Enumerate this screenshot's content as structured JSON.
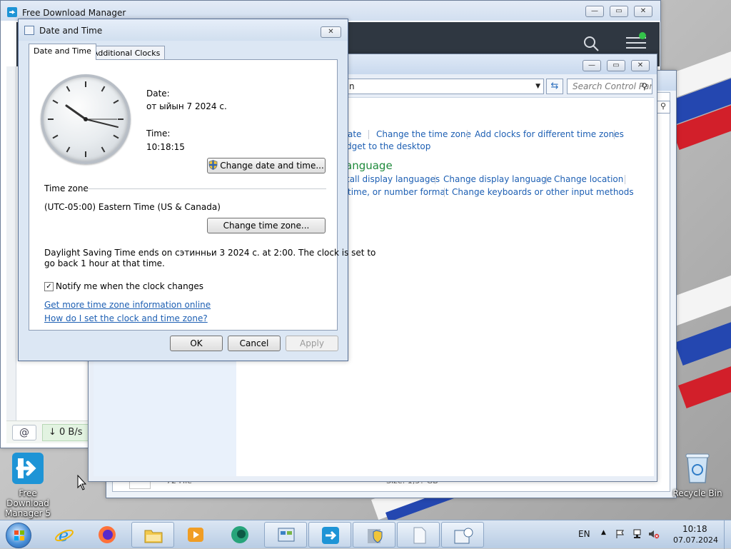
{
  "fdm": {
    "title": "Free Download Manager",
    "search_icon": "search-icon",
    "menu_icon": "hamburger-menu-icon",
    "speed": "↓  0 B/s"
  },
  "control_panel": {
    "address_fragment": "n",
    "search_placeholder": "Search Control Panel",
    "heading_datetime": "e",
    "heading_language": "anguage",
    "links": {
      "set_date": "ate",
      "change_time_zone": "Change the time zone",
      "add_clocks": "Add clocks for different time zones",
      "gadget": "dget to the desktop",
      "install_languages": "tall display languages",
      "change_display_language": "Change display language",
      "change_location": "Change location",
      "change_format": "time, or number format",
      "change_keyboards": "Change keyboards or other input methods"
    }
  },
  "back_window": {
    "row_name": "72 File",
    "row_size": "Size: 1,5? GB"
  },
  "dialog": {
    "title": "Date and Time",
    "close_glyph": "✕",
    "tabs": [
      "Date and Time",
      "Additional Clocks"
    ],
    "date_label": "Date:",
    "date_value": "от ыйын 7 2024 с.",
    "time_label": "Time:",
    "time_value": "10:18:15",
    "change_datetime_button": "Change date and time...",
    "timezone_section": "Time zone",
    "timezone_value": "(UTC-05:00) Eastern Time (US & Canada)",
    "change_timezone_button": "Change time zone...",
    "dst_line1": "Daylight Saving Time ends on сэтинньи 3 2024 с. at 2:00. The clock is set to",
    "dst_line2": "go back 1 hour at that time.",
    "notify_checkbox": "Notify me when the clock changes",
    "notify_checked": true,
    "link_more_info": "Get more time zone information online",
    "link_how_to": "How do I set the clock and time zone?",
    "ok_button": "OK",
    "cancel_button": "Cancel",
    "apply_button": "Apply"
  },
  "desktop": {
    "icons": [
      {
        "name": "Free Download Manager 5",
        "label_lines": [
          "Free",
          "Download",
          "Manager 5"
        ]
      },
      {
        "name": "Recycle Bin",
        "label": "Recycle Bin"
      }
    ]
  },
  "taskbar": {
    "language": "EN",
    "clock_time": "10:18",
    "clock_date": "07.07.2024",
    "items": [
      "start",
      "internet-explorer",
      "firefox",
      "file-explorer",
      "media-player",
      "green-app",
      "control-panel",
      "free-download-manager",
      "security-installer",
      "blank-document",
      "date-time"
    ]
  },
  "colors": {
    "link": "#1d5fb3",
    "heading_green": "#1e8a3b",
    "fdm_header": "#2f3741"
  }
}
